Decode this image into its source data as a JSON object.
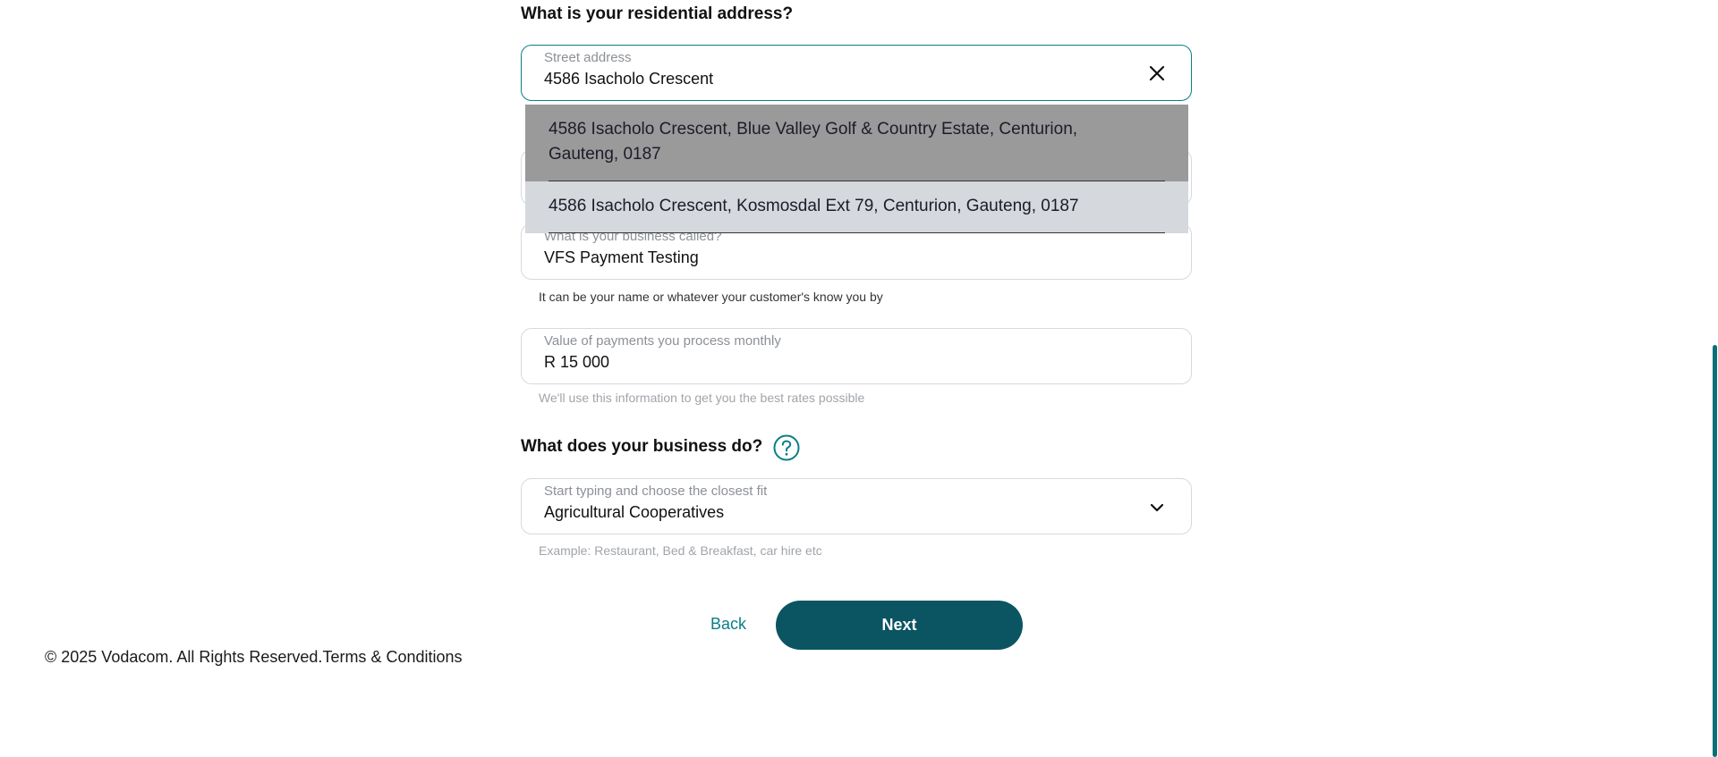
{
  "address_section": {
    "question": "What is your residential address?",
    "street_label": "Street address",
    "street_value": "4586 Isacholo Crescent",
    "suggestions": [
      "4586 Isacholo Crescent, Blue Valley Golf & Country Estate, Centurion, Gauteng, 0187",
      "4586 Isacholo Crescent, Kosmosdal Ext 79, Centurion, Gauteng, 0187"
    ]
  },
  "business_name": {
    "label": "What is your business called?",
    "value": "VFS Payment Testing",
    "hint": "It can be your name or whatever your customer's know you by"
  },
  "monthly_value": {
    "label": "Value of payments you process monthly",
    "value": "R 15 000",
    "hint": "We'll use this information to get you the best rates possible"
  },
  "business_type": {
    "question": "What does your business do?",
    "label": "Start typing and choose the closest fit",
    "value": "Agricultural Cooperatives",
    "hint": "Example: Restaurant, Bed & Breakfast, car hire etc"
  },
  "actions": {
    "back": "Back",
    "next": "Next"
  },
  "footer": {
    "copyright": "© 2025 Vodacom. All Rights Reserved.",
    "terms": "Terms & Conditions"
  },
  "icons": {
    "clear": "close-icon",
    "help": "help-icon",
    "dropdown": "chevron-down-icon"
  },
  "colors": {
    "accent": "#0a7e87",
    "primary_button": "#0b5563",
    "scrollbar": "#0b6f78"
  }
}
